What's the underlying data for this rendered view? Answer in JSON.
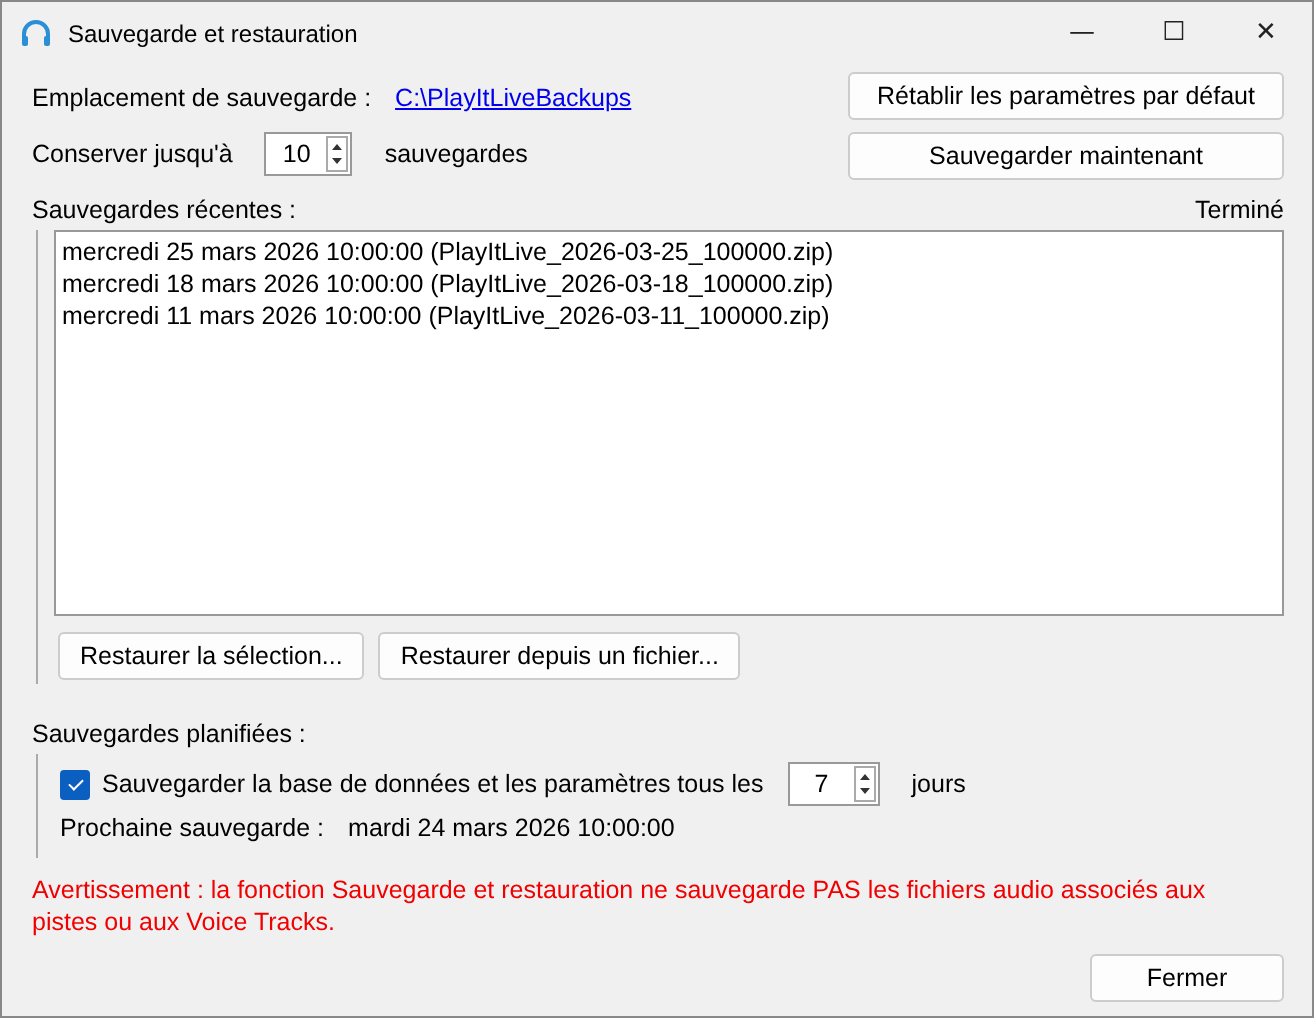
{
  "window": {
    "title": "Sauvegarde et restauration",
    "controls": [
      "—",
      "☐",
      "✕"
    ]
  },
  "location": {
    "label": "Emplacement de sauvegarde :",
    "path": "C:\\PlayItLiveBackups"
  },
  "keep": {
    "label": "Conserver jusqu'à",
    "value": "10",
    "unit": "sauvegardes"
  },
  "buttons_top": [
    "Rétablir les paramètres par défaut",
    "Sauvegarder maintenant"
  ],
  "recent": {
    "label": "Sauvegardes récentes :",
    "status": "Terminé",
    "items": [
      {
        "text": "mercredi 25 mars 2026 10:00:00 (PlayItLive_2026-03-25_100000.zip)",
        "selected": false
      },
      {
        "text": "mercredi 18 mars 2026 10:00:00 (PlayItLive_2026-03-18_100000.zip)",
        "selected": false
      },
      {
        "text": "mercredi 11 mars 2026 10:00:00 (PlayItLive_2026-03-11_100000.zip)",
        "selected": false
      }
    ]
  },
  "restore_buttons": [
    "Restaurer la sélection...",
    "Restaurer depuis un fichier..."
  ],
  "scheduled": {
    "label": "Sauvegardes planifiées :",
    "checkbox_label": "Sauvegarder la base de données et les paramètres tous les",
    "checked": true,
    "days": "7",
    "unit": "jours",
    "next_label": "Prochaine sauvegarde :",
    "next_value": "mardi 24 mars 2026 10:00:00"
  },
  "warning": "Avertissement : la fonction Sauvegarde et restauration ne sauvegarde PAS les fichiers audio associés aux pistes ou aux Voice Tracks.",
  "close_button": "Fermer"
}
